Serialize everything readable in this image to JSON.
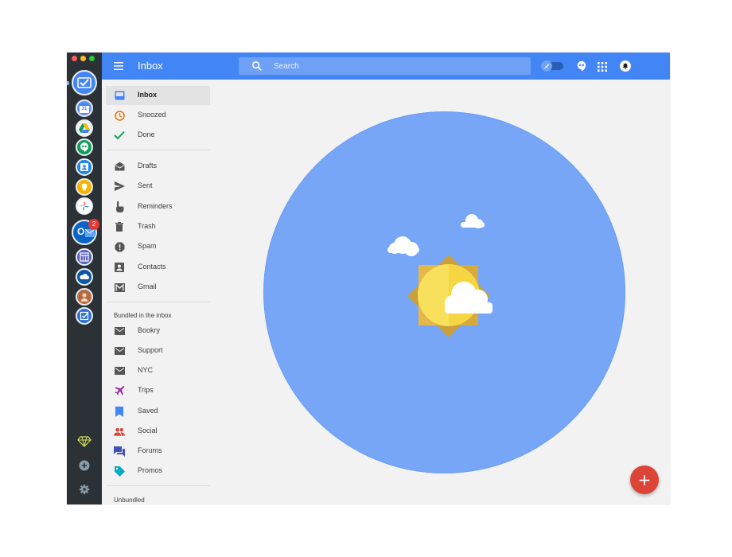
{
  "header": {
    "title": "Inbox",
    "search_placeholder": "Search"
  },
  "rail": {
    "calendar_date": "31",
    "outlook_letter": "O",
    "outlook_badge": "2"
  },
  "nav": {
    "primary": [
      {
        "label": "Inbox",
        "icon": "inbox-icon",
        "active": true
      },
      {
        "label": "Snoozed",
        "icon": "clock-icon"
      },
      {
        "label": "Done",
        "icon": "checkmark-icon"
      }
    ],
    "folders": [
      {
        "label": "Drafts",
        "icon": "drafts-icon"
      },
      {
        "label": "Sent",
        "icon": "send-icon"
      },
      {
        "label": "Reminders",
        "icon": "reminder-hand-icon"
      },
      {
        "label": "Trash",
        "icon": "trash-icon"
      },
      {
        "label": "Spam",
        "icon": "spam-icon"
      },
      {
        "label": "Contacts",
        "icon": "contacts-icon"
      },
      {
        "label": "Gmail",
        "icon": "gmail-icon"
      }
    ],
    "bundled_heading": "Bundled in the inbox",
    "bundles": [
      {
        "label": "Bookry",
        "icon": "mail-icon"
      },
      {
        "label": "Support",
        "icon": "mail-icon"
      },
      {
        "label": "NYC",
        "icon": "mail-icon"
      },
      {
        "label": "Trips",
        "icon": "airplane-icon"
      },
      {
        "label": "Saved",
        "icon": "bookmark-icon"
      },
      {
        "label": "Social",
        "icon": "people-icon"
      },
      {
        "label": "Forums",
        "icon": "forum-icon"
      },
      {
        "label": "Promos",
        "icon": "tag-icon"
      }
    ],
    "unbundled_heading": "Unbundled"
  },
  "colors": {
    "header_blue": "#4285f4",
    "rail_dark": "#2b3135",
    "empty_state_circle": "#77a6f7",
    "compose_red": "#db4437",
    "trips_purple": "#9c27b0",
    "saved_blue": "#4285f4",
    "social_red": "#db4437",
    "forums_indigo": "#3f51b5",
    "promos_teal": "#00acc1",
    "snoozed_orange": "#ef6c00",
    "done_green": "#0f9d58"
  },
  "compose": {
    "label": "+"
  }
}
